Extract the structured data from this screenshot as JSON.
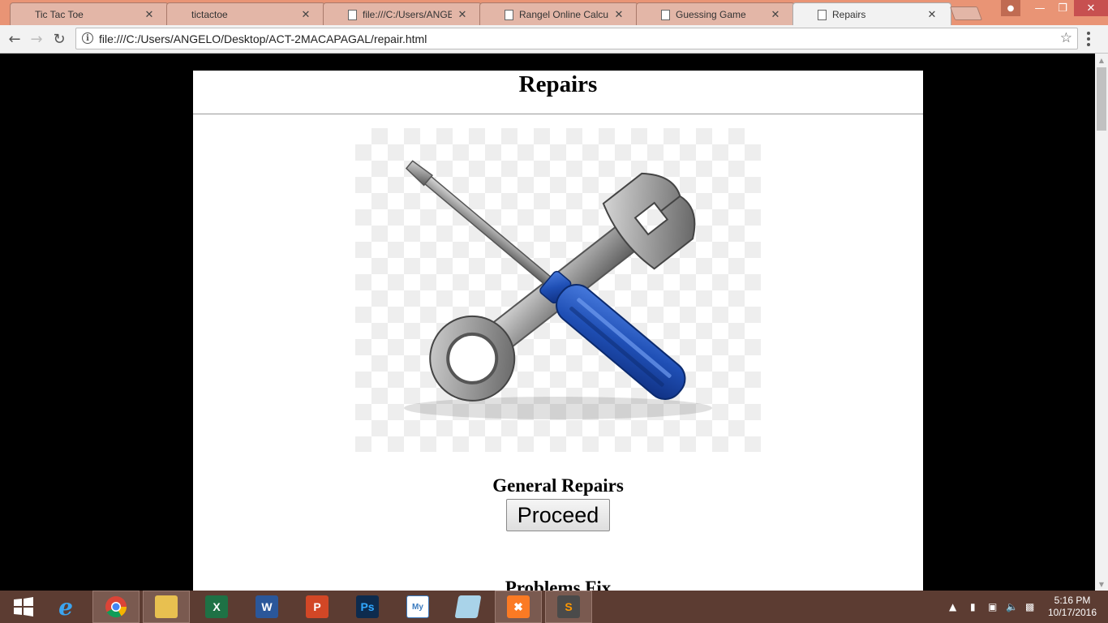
{
  "browser": {
    "tabs": [
      {
        "label": "Tic Tac Toe"
      },
      {
        "label": "tictactoe"
      },
      {
        "label": "file:///C:/Users/ANGELO/"
      },
      {
        "label": "Rangel Online Calculator"
      },
      {
        "label": "Guessing Game"
      },
      {
        "label": "Repairs"
      }
    ],
    "active_tab": 5,
    "tab_close": "✕",
    "url": "file:///C:/Users/ANGELO/Desktop/ACT-2MACAPAGAL/repair.html"
  },
  "page": {
    "title": "Repairs",
    "hero_image": "wrench-and-screwdriver",
    "section1_title": "General Repairs",
    "proceed_label": "Proceed",
    "section2_title": "Problems Fix"
  },
  "taskbar": {
    "apps": [
      "start",
      "internet-explorer",
      "chrome",
      "file-explorer",
      "excel",
      "word",
      "powerpoint",
      "photoshop",
      "mysql-workbench",
      "notepad",
      "xampp",
      "sublime-text"
    ],
    "clock_time": "5:16 PM",
    "clock_date": "10/17/2016"
  },
  "colors": {
    "tabstrip": "#e99475",
    "taskbar": "#5c3c32",
    "screwdriver_handle": "#1f4fb5"
  }
}
